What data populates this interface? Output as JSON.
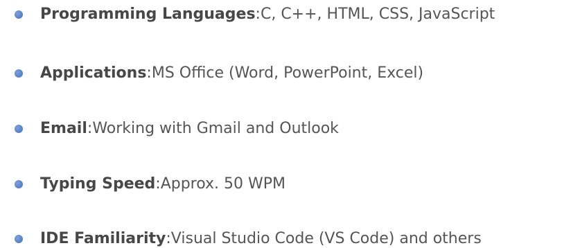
{
  "skills": [
    {
      "name": "Programming Languages",
      "separator": ":",
      "value": " C, C++, HTML, CSS, JavaScript"
    },
    {
      "name": "Applications",
      "separator": ":",
      "value": " MS Office (Word, PowerPoint, Excel)"
    },
    {
      "name": "Email",
      "separator": ":",
      "value": " Working with Gmail and Outlook"
    },
    {
      "name": "Typing Speed",
      "separator": ":",
      "value": " Approx. 50 WPM"
    },
    {
      "name": "IDE Familiarity",
      "separator": ":",
      "value": " Visual Studio Code (VS Code) and others"
    }
  ],
  "colors": {
    "bullet": "#5f86c7",
    "label": "#474747",
    "text": "#555555"
  }
}
